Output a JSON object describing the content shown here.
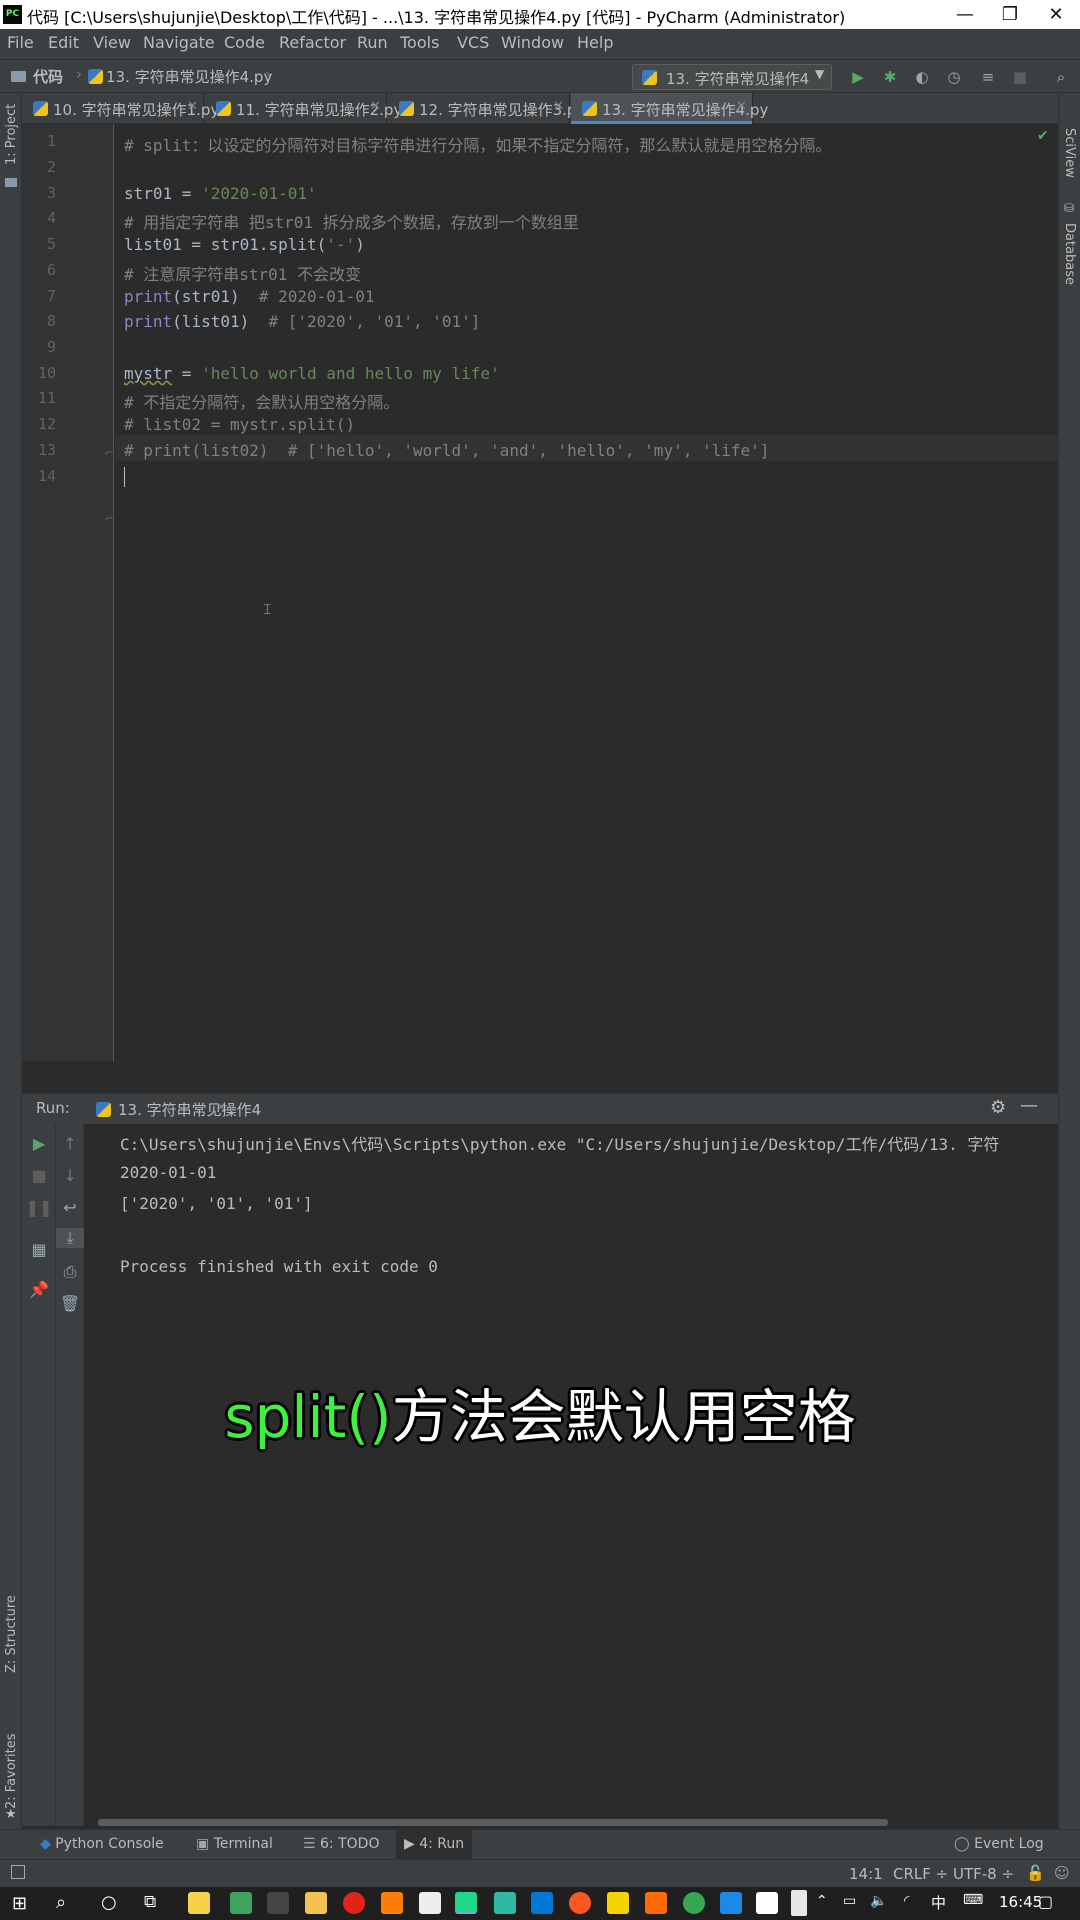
{
  "window": {
    "title": "代码 [C:\\Users\\shujunjie\\Desktop\\工作\\代码] - ...\\13. 字符串常见操作4.py [代码] - PyCharm (Administrator)",
    "app_icon_text": "PC",
    "controls": {
      "minimize": "—",
      "restore": "❐",
      "close": "✕"
    }
  },
  "menu": [
    "File",
    "Edit",
    "View",
    "Navigate",
    "Code",
    "Refactor",
    "Run",
    "Tools",
    "VCS",
    "Window",
    "Help"
  ],
  "breadcrumb": {
    "project": "代码",
    "file": "13. 字符串常见操作4.py"
  },
  "run_config": {
    "name": "13. 字符串常见操作4"
  },
  "tabs": [
    {
      "label": "10. 字符串常见操作1.py",
      "active": false
    },
    {
      "label": "11. 字符串常见操作2.py",
      "active": false
    },
    {
      "label": "12. 字符串常见操作3.py",
      "active": false
    },
    {
      "label": "13. 字符串常见操作4.py",
      "active": true
    }
  ],
  "side_left": {
    "project": "1: Project",
    "structure": "Z: Structure",
    "favorites": "2: Favorites"
  },
  "side_right": {
    "sciview": "SciView",
    "database": "Database"
  },
  "code_lines": [
    {
      "n": "1",
      "text": "# split：以设定的分隔符对目标字符串进行分隔，如果不指定分隔符，那么默认就是用空格分隔。"
    },
    {
      "n": "2",
      "text": ""
    },
    {
      "n": "3",
      "text": "str01 = '2020-01-01'"
    },
    {
      "n": "4",
      "text": "# 用指定字符串 把str01 拆分成多个数据，存放到一个数组里"
    },
    {
      "n": "5",
      "text": "list01 = str01.split('-')"
    },
    {
      "n": "6",
      "text": "# 注意原字符串str01 不会改变"
    },
    {
      "n": "7",
      "text": "print(str01)  # 2020-01-01"
    },
    {
      "n": "8",
      "text": "print(list01)  # ['2020', '01', '01']"
    },
    {
      "n": "9",
      "text": ""
    },
    {
      "n": "10",
      "text": "mystr = 'hello world and hello my life'"
    },
    {
      "n": "11",
      "text": "# 不指定分隔符，会默认用空格分隔。"
    },
    {
      "n": "12",
      "text": "# list02 = mystr.split()"
    },
    {
      "n": "13",
      "text": "# print(list02)  # ['hello', 'world', 'and', 'hello', 'my', 'life']"
    },
    {
      "n": "14",
      "text": ""
    }
  ],
  "code_tokens": {
    "l3a": "str01 = ",
    "l3b": "'2020-01-01'",
    "l5a": "list01 = str01.split(",
    "l5b": "'-'",
    "l5c": ")",
    "l7a": "print",
    "l7b": "(str01)  ",
    "l7c": "# 2020-01-01",
    "l8a": "print",
    "l8b": "(list01)  ",
    "l8c": "# ['2020', '01', '01']",
    "l10a": "mystr",
    "l10b": " = ",
    "l10c": "'hello world and hello my life'"
  },
  "run_panel": {
    "label": "Run:",
    "tab": "13. 字符串常见操作4",
    "output": [
      "C:\\Users\\shujunjie\\Envs\\代码\\Scripts\\python.exe \"C:/Users/shujunjie/Desktop/工作/代码/13. 字符",
      "2020-01-01",
      "['2020', '01', '01']",
      "",
      "Process finished with exit code 0"
    ]
  },
  "caption": {
    "highlight": "split()",
    "rest": "方法会默认用空格"
  },
  "bottom_tools": [
    "Python Console",
    "Terminal",
    "6: TODO",
    "4: Run",
    "Event Log"
  ],
  "status": {
    "position": "14:1",
    "line_sep": "CRLF ÷",
    "encoding": "UTF-8 ÷"
  },
  "taskbar": {
    "time": "16:45",
    "ime": "中"
  }
}
